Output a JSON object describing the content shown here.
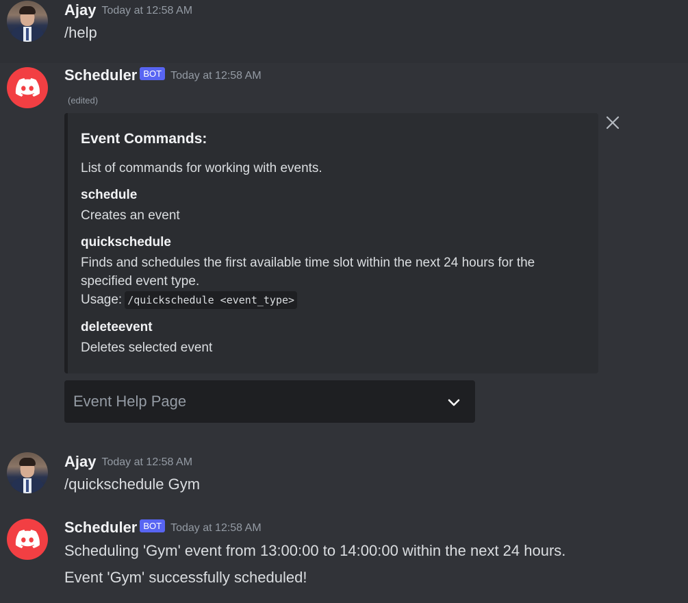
{
  "messages": {
    "m1": {
      "author": "Ajay",
      "timestamp": "Today at 12:58 AM",
      "content": "/help"
    },
    "m2": {
      "author": "Scheduler",
      "badge": "BOT",
      "timestamp": "Today at 12:58 AM",
      "edited": "(edited)",
      "embed": {
        "title": "Event Commands:",
        "description": "List of commands for working with events.",
        "fields": [
          {
            "name": "schedule",
            "value": "Creates an event"
          },
          {
            "name": "quickschedule",
            "value": "Finds and schedules the first available time slot within the next 24 hours for the specified event type.",
            "usage_label": "Usage:",
            "usage_code": "/quickschedule <event_type>"
          },
          {
            "name": "deleteevent",
            "value": "Deletes selected event"
          }
        ]
      },
      "select": {
        "placeholder": "Event Help Page"
      }
    },
    "m3": {
      "author": "Ajay",
      "timestamp": "Today at 12:58 AM",
      "content": "/quickschedule Gym"
    },
    "m4": {
      "author": "Scheduler",
      "badge": "BOT",
      "timestamp": "Today at 12:58 AM",
      "lines": [
        "Scheduling 'Gym' event from 13:00:00 to 14:00:00 within the next 24 hours.",
        "Event 'Gym' successfully scheduled!"
      ]
    }
  },
  "icons": {
    "user_avatar": "user-avatar",
    "bot_avatar": "discord-logo-icon",
    "close": "close-icon",
    "select_chevron": "chevron-down-icon"
  },
  "colors": {
    "background": "#313338",
    "bot_avatar": "#f23f43",
    "bot_badge": "#5865f2",
    "embed_bg": "#2b2d31",
    "select_bg": "#1e1f22"
  }
}
